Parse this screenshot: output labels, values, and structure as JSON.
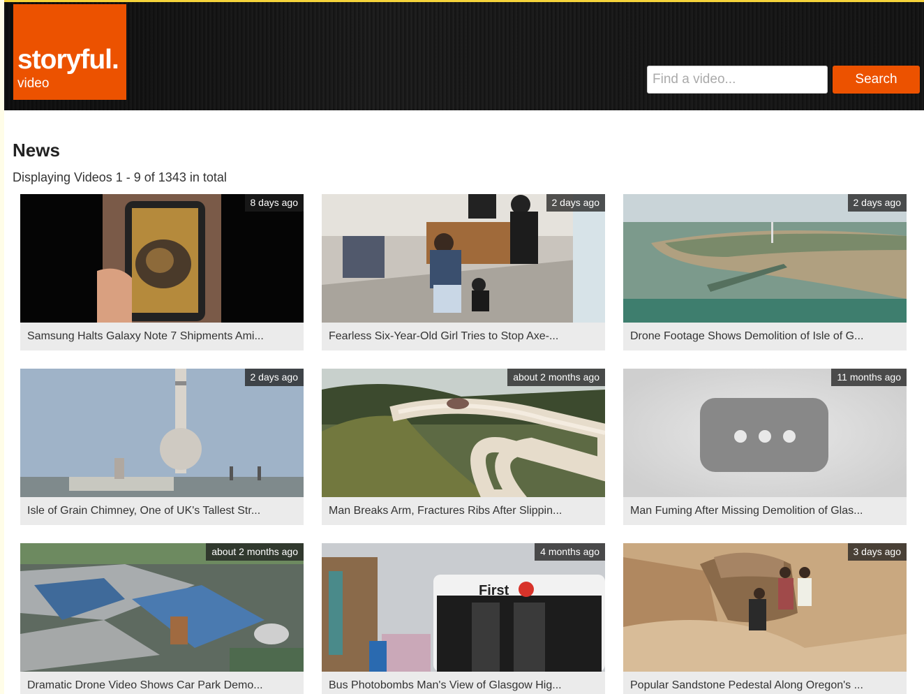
{
  "header": {
    "logo_main": "storyful.",
    "logo_sub": "video",
    "search_placeholder": "Find a video...",
    "search_button": "Search"
  },
  "main": {
    "title": "News",
    "count_text": "Displaying Videos 1 - 9 of 1343 in total"
  },
  "videos": [
    {
      "title": "Samsung Halts Galaxy Note 7 Shipments Ami...",
      "age": "8 days ago"
    },
    {
      "title": "Fearless Six-Year-Old Girl Tries to Stop Axe-...",
      "age": "2 days ago"
    },
    {
      "title": "Drone Footage Shows Demolition of Isle of G...",
      "age": "2 days ago"
    },
    {
      "title": "Isle of Grain Chimney, One of UK's Tallest Str...",
      "age": "2 days ago"
    },
    {
      "title": "Man Breaks Arm, Fractures Ribs After Slippin...",
      "age": "about 2 months ago"
    },
    {
      "title": "Man Fuming After Missing Demolition of Glas...",
      "age": "11 months ago"
    },
    {
      "title": "Dramatic Drone Video Shows Car Park Demo...",
      "age": "about 2 months ago"
    },
    {
      "title": "Bus Photobombs Man's View of Glasgow Hig...",
      "age": "4 months ago"
    },
    {
      "title": "Popular Sandstone Pedestal Along Oregon's ...",
      "age": "3 days ago"
    }
  ],
  "thumb_labels": {
    "bus_brand": "First"
  },
  "colors": {
    "brand_orange": "#ec5200"
  }
}
